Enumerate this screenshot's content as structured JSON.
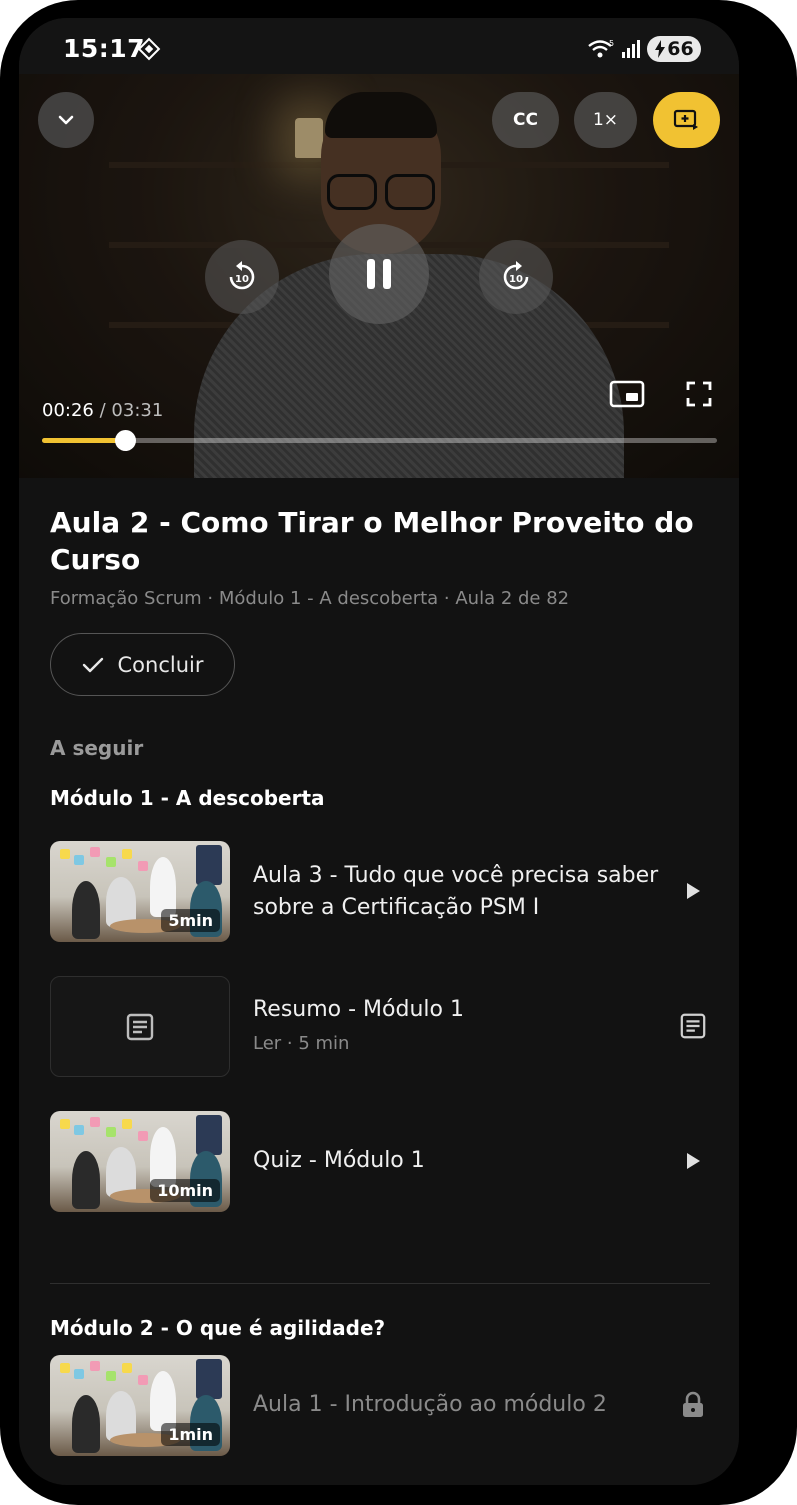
{
  "status_bar": {
    "time": "15:17",
    "battery": "66"
  },
  "player": {
    "current_time": "00:26",
    "separator": "/",
    "duration": "03:31",
    "progress_fraction": 0.123,
    "cc_label": "CC",
    "speed_label": "1×",
    "accent_color": "#f1c232"
  },
  "lesson": {
    "title": "Aula 2 - Como Tirar o Melhor Proveito do Curso",
    "breadcrumb": "Formação Scrum · Módulo 1 - A descoberta · Aula 2 de 82",
    "complete_label": "Concluir"
  },
  "up_next": {
    "heading": "A seguir",
    "modules": [
      {
        "title": "Módulo 1 - A descoberta",
        "items": [
          {
            "title": "Aula 3 - Tudo que você precisa saber sobre a Certificação PSM I",
            "duration": "5min",
            "kind": "video",
            "action_icon": "play-icon"
          },
          {
            "title": "Resumo - Módulo 1",
            "subtitle": "Ler · 5 min",
            "kind": "reading",
            "action_icon": "document-icon"
          },
          {
            "title": "Quiz - Módulo 1",
            "duration": "10min",
            "kind": "video",
            "action_icon": "play-icon"
          }
        ]
      },
      {
        "title": "Módulo 2 - O que é agilidade?",
        "items": [
          {
            "title": "Aula 1 - Introdução ao módulo 2",
            "duration": "1min",
            "kind": "video",
            "action_icon": "lock-icon",
            "locked": true
          }
        ]
      }
    ]
  }
}
